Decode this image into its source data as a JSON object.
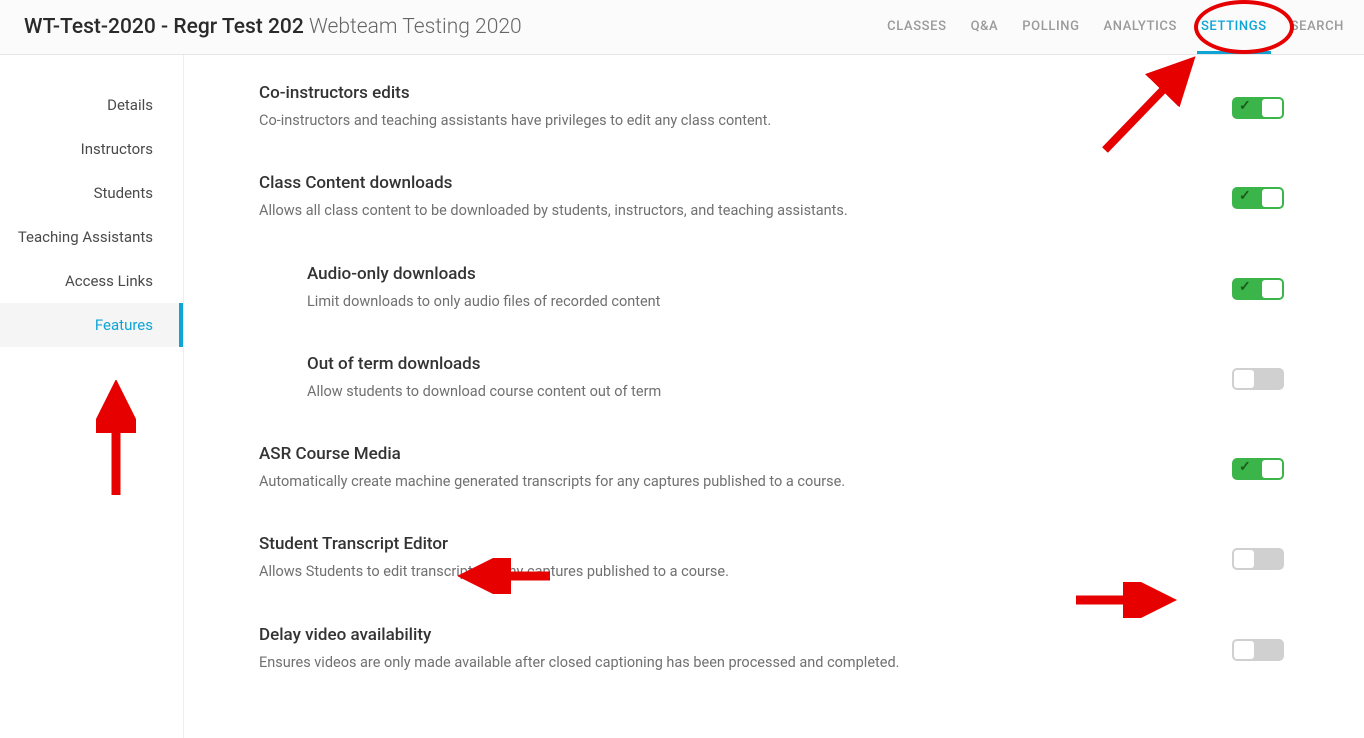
{
  "header": {
    "title_bold": "WT-Test-2020 - Regr Test 202",
    "title_light": "Webteam Testing 2020",
    "tabs": [
      {
        "label": "CLASSES",
        "active": false
      },
      {
        "label": "Q&A",
        "active": false
      },
      {
        "label": "POLLING",
        "active": false
      },
      {
        "label": "ANALYTICS",
        "active": false
      },
      {
        "label": "SETTINGS",
        "active": true
      },
      {
        "label": "SEARCH",
        "active": false
      }
    ]
  },
  "sidebar": {
    "items": [
      {
        "label": "Details",
        "active": false
      },
      {
        "label": "Instructors",
        "active": false
      },
      {
        "label": "Students",
        "active": false
      },
      {
        "label": "Teaching Assistants",
        "active": false
      },
      {
        "label": "Access Links",
        "active": false
      },
      {
        "label": "Features",
        "active": true
      }
    ]
  },
  "settings": [
    {
      "title": "Co-instructors edits",
      "desc": "Co-instructors and teaching assistants have privileges to edit any class content.",
      "on": true,
      "sub": false
    },
    {
      "title": "Class Content downloads",
      "desc": "Allows all class content to be downloaded by students, instructors, and teaching assistants.",
      "on": true,
      "sub": false
    },
    {
      "title": "Audio-only downloads",
      "desc": "Limit downloads to only audio files of recorded content",
      "on": true,
      "sub": true
    },
    {
      "title": "Out of term downloads",
      "desc": "Allow students to download course content out of term",
      "on": false,
      "sub": true
    },
    {
      "title": "ASR Course Media",
      "desc": "Automatically create machine generated transcripts for any captures published to a course.",
      "on": true,
      "sub": false
    },
    {
      "title": "Student Transcript Editor",
      "desc": "Allows Students to edit transcripts of any captures published to a course.",
      "on": false,
      "sub": false
    },
    {
      "title": "Delay video availability",
      "desc": "Ensures videos are only made available after closed captioning has been processed and completed.",
      "on": false,
      "sub": false
    }
  ]
}
